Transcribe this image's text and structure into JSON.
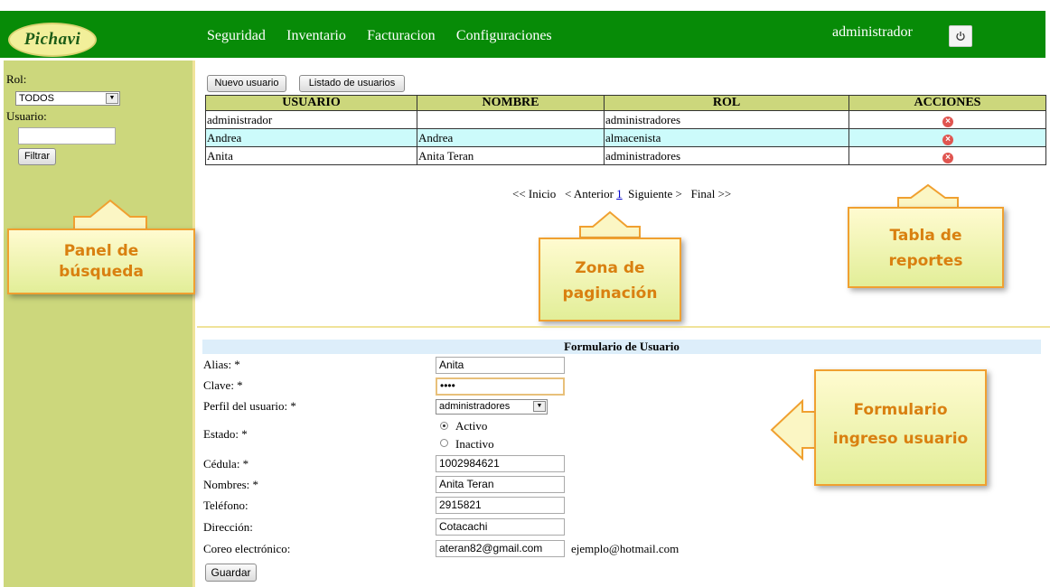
{
  "brand": {
    "logo_text": "Pichavi"
  },
  "nav": {
    "items": [
      "Seguridad",
      "Inventario",
      "Facturacion",
      "Configuraciones"
    ]
  },
  "header": {
    "username": "administrador"
  },
  "sidebar": {
    "rol_label": "Rol:",
    "rol_value": "TODOS",
    "usuario_label": "Usuario:",
    "usuario_value": "",
    "filter_button": "Filtrar"
  },
  "toolbar": {
    "new_user": "Nuevo usuario",
    "list_users": "Listado de usuarios"
  },
  "table": {
    "headers": [
      "USUARIO",
      "NOMBRE",
      "ROL",
      "ACCIONES"
    ],
    "rows": [
      {
        "usuario": "administrador",
        "nombre": "",
        "rol": "administradores"
      },
      {
        "usuario": "Andrea",
        "nombre": "Andrea",
        "rol": "almacenista"
      },
      {
        "usuario": "Anita",
        "nombre": "Anita Teran",
        "rol": "administradores"
      }
    ]
  },
  "pager": {
    "first": "<< Inicio",
    "prev": "< Anterior",
    "current": "1",
    "next": "Siguiente >",
    "last": "Final >>"
  },
  "form": {
    "title": "Formulario de Usuario",
    "alias_label": "Alias: *",
    "alias_value": "Anita",
    "clave_label": "Clave: *",
    "clave_value": "••••",
    "perfil_label": "Perfil del usuario: *",
    "perfil_value": "administradores",
    "estado_label": "Estado: *",
    "estado_activo": "Activo",
    "estado_inactivo": "Inactivo",
    "cedula_label": "Cédula: *",
    "cedula_value": "1002984621",
    "nombres_label": "Nombres: *",
    "nombres_value": "Anita Teran",
    "telefono_label": "Teléfono:",
    "telefono_value": "2915821",
    "direccion_label": "Dirección:",
    "direccion_value": "Cotacachi",
    "correo_label": "Coreo electrónico:",
    "correo_value": "ateran82@gmail.com",
    "correo_hint": "ejemplo@hotmail.com",
    "save_button": "Guardar"
  },
  "callouts": {
    "panel": [
      "Panel de",
      "búsqueda"
    ],
    "pagination": [
      "Zona de",
      "paginación"
    ],
    "reports": [
      "Tabla de",
      "reportes"
    ],
    "form": [
      "Formulario",
      "ingreso usuario"
    ]
  },
  "colors": {
    "header_green": "#078b07",
    "sidebar": "#ccd77c",
    "table_alt_row": "#ccfbfb",
    "callout_text": "#d98010"
  }
}
